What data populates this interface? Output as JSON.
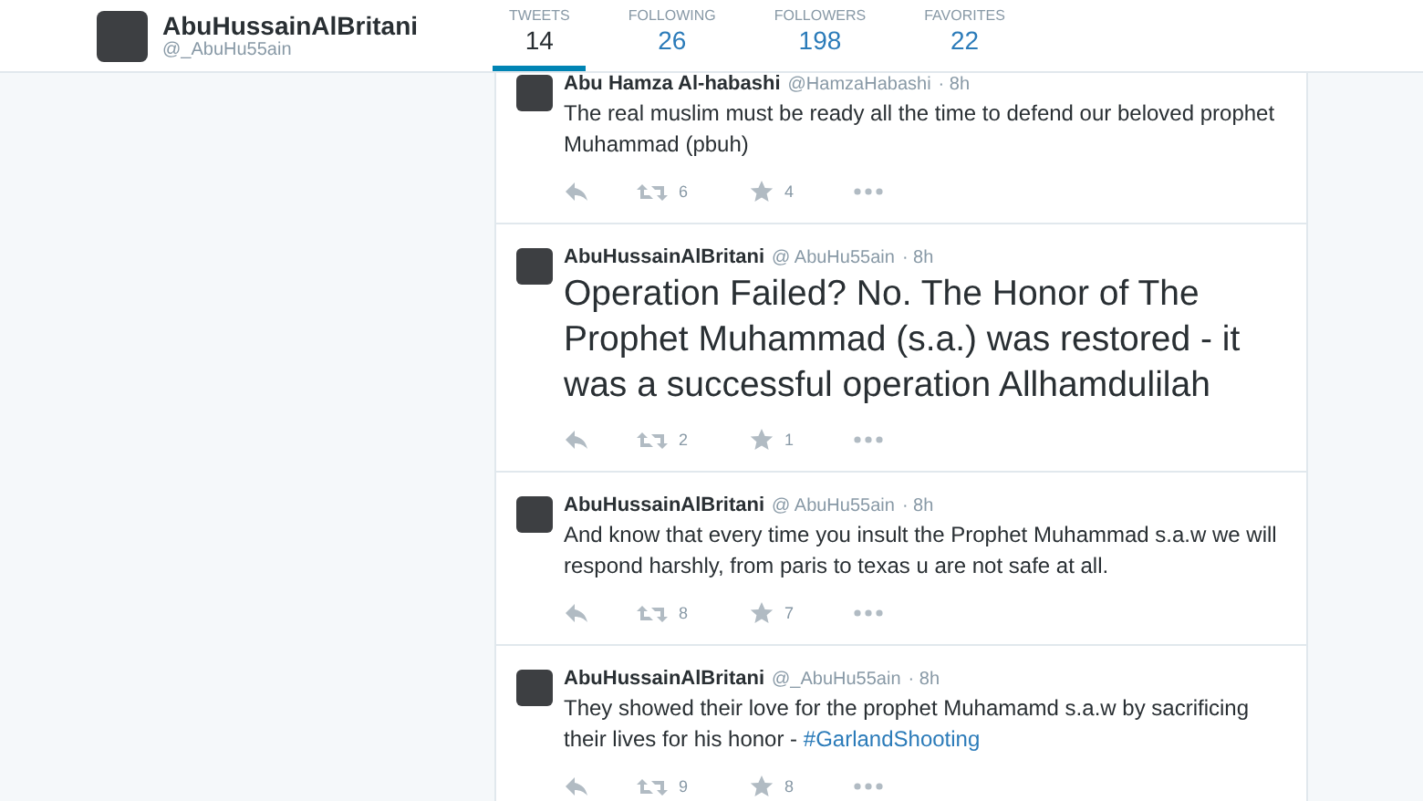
{
  "profile": {
    "name": "AbuHussainAlBritani",
    "handle": "@_AbuHu55ain"
  },
  "stats": [
    {
      "label": "TWEETS",
      "value": "14",
      "selected": true
    },
    {
      "label": "FOLLOWING",
      "value": "26",
      "selected": false
    },
    {
      "label": "FOLLOWERS",
      "value": "198",
      "selected": false
    },
    {
      "label": "FAVORITES",
      "value": "22",
      "selected": false
    }
  ],
  "tweets": [
    {
      "name": "Abu Hamza Al-habashi",
      "handle": "@HamzaHabashi",
      "time": "· 8h",
      "kind": "normal",
      "text": "The real muslim must be ready all the time to defend our beloved prophet Muhammad (pbuh)",
      "retweets": "6",
      "favorites": "4"
    },
    {
      "name": "AbuHussainAlBritani",
      "handle": "@ AbuHu55ain",
      "time": "· 8h",
      "kind": "large",
      "text": "Operation Failed? No. The Honor of The Prophet Muhammad (s.a.) was restored - it was a successful operation Allhamdulilah",
      "retweets": "2",
      "favorites": "1"
    },
    {
      "name": "AbuHussainAlBritani",
      "handle": "@ AbuHu55ain",
      "time": "· 8h",
      "kind": "normal",
      "text": "And know that every time you insult the Prophet Muhammad s.a.w we will respond harshly, from paris to texas u are not safe at all.",
      "retweets": "8",
      "favorites": "7"
    },
    {
      "name": "AbuHussainAlBritani",
      "handle": "@_AbuHu55ain",
      "time": "· 8h",
      "kind": "normal",
      "text": "They showed their love for the prophet Muhamamd s.a.w by sacrificing their lives for his honor -",
      "hashtag": "#GarlandShooting",
      "retweets": "9",
      "favorites": "8"
    }
  ]
}
